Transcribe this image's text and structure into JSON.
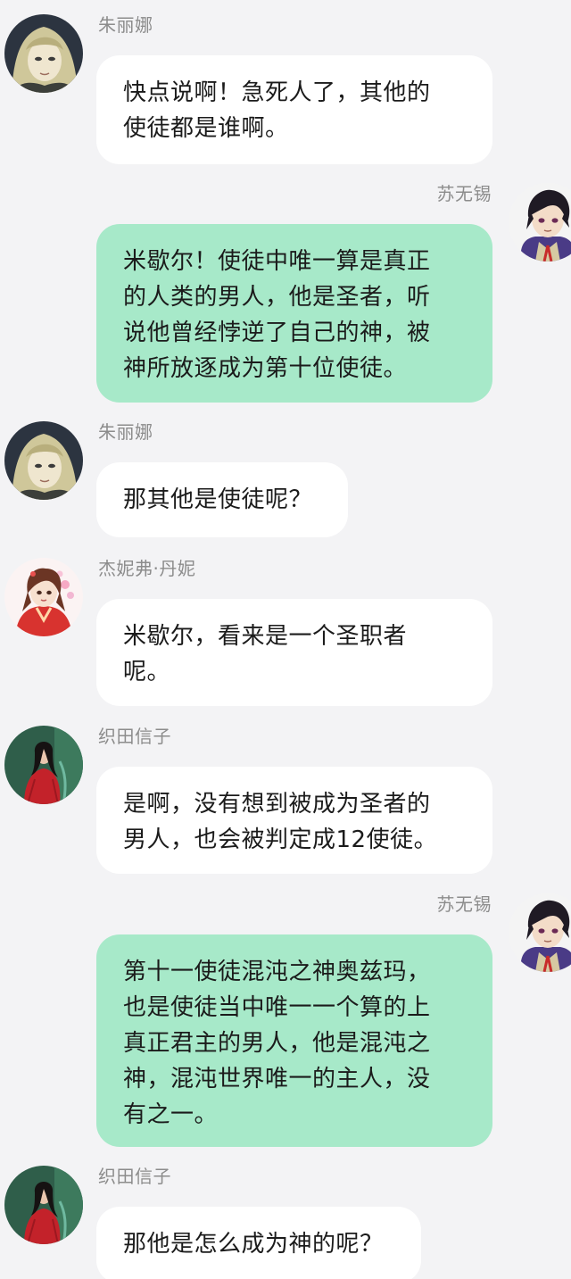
{
  "colors": {
    "background": "#f3f3f5",
    "incoming_bubble": "#ffffff",
    "outgoing_bubble": "#a7e9c9",
    "name_text": "#8c8c8c",
    "message_text": "#1b1b1b"
  },
  "messages": [
    {
      "sender": "朱丽娜",
      "side": "left",
      "avatar_icon": "blonde-anime-character-avatar-icon",
      "text": "快点说啊！急死人了，其他的\n使徒都是谁啊。"
    },
    {
      "sender": "苏无锡",
      "side": "right",
      "avatar_icon": "dark-haired-anime-character-avatar-icon",
      "text": "米歇尔！使徒中唯一算是真正\n的人类的男人，他是圣者，听\n说他曾经悖逆了自己的神，被\n神所放逐成为第十位使徒。"
    },
    {
      "sender": "朱丽娜",
      "side": "left",
      "avatar_icon": "blonde-anime-character-avatar-icon",
      "text": "那其他是使徒呢？"
    },
    {
      "sender": "杰妮弗·丹妮",
      "side": "left",
      "avatar_icon": "red-kimono-girl-avatar-icon",
      "text": "米歇尔，看来是一个圣职者\n呢。"
    },
    {
      "sender": "织田信子",
      "side": "left",
      "avatar_icon": "woman-in-red-dress-avatar-icon",
      "text": "是啊，没有想到被成为圣者的\n男人，也会被判定成12使徒。"
    },
    {
      "sender": "苏无锡",
      "side": "right",
      "avatar_icon": "dark-haired-anime-character-avatar-icon",
      "text": "第十一使徒混沌之神奥兹玛，\n也是使徒当中唯一一个算的上\n真正君主的男人，他是混沌之\n神，混沌世界唯一的主人，没\n有之一。"
    },
    {
      "sender": "织田信子",
      "side": "left",
      "avatar_icon": "woman-in-red-dress-avatar-icon",
      "text": "那他是怎么成为神的呢？"
    }
  ]
}
